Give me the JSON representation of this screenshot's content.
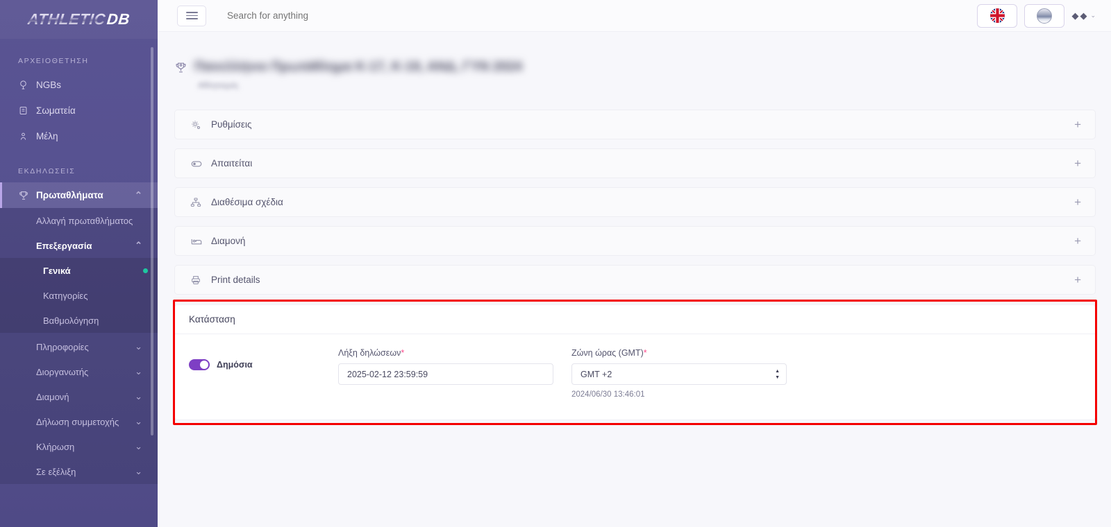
{
  "brand": {
    "name_part1": "ATHLETIC",
    "name_part2": "DB"
  },
  "topbar": {
    "menu_toggle": "hamburger-menu",
    "search_placeholder": "Search for anything",
    "search_value": "",
    "language_icon": "uk-flag-icon",
    "theme_icon": "globe-icon",
    "avatar_caret": "⌄"
  },
  "sidebar": {
    "sections": [
      {
        "label": "ΑΡΧΕΙΟΘΕΤΗΣΗ",
        "items": [
          {
            "label": "NGBs",
            "icon": "globe-icon"
          },
          {
            "label": "Σωματεία",
            "icon": "building-icon"
          },
          {
            "label": "Μέλη",
            "icon": "person-pin-icon"
          }
        ]
      },
      {
        "label": "ΕΚΔΗΛΩΣΕΙΣ",
        "items": [
          {
            "label": "Πρωταθλήματα",
            "icon": "trophy-icon",
            "active": true,
            "chevron": "⌃"
          }
        ]
      }
    ],
    "submenu": [
      {
        "label": "Αλλαγή πρωταθλήματος"
      },
      {
        "label": "Επεξεργασία",
        "chevron": "⌃",
        "bold": true
      }
    ],
    "editing_items": [
      {
        "label": "Γενικά",
        "current": true,
        "dot": true
      },
      {
        "label": "Κατηγορίες"
      },
      {
        "label": "Βαθμολόγηση"
      }
    ],
    "more_items": [
      {
        "label": "Πληροφορίες",
        "chevron": "⌄"
      },
      {
        "label": "Διοργανωτής",
        "chevron": "⌄"
      },
      {
        "label": "Διαμονή",
        "chevron": "⌄"
      },
      {
        "label": "Δήλωση συμμετοχής",
        "chevron": "⌄"
      },
      {
        "label": "Κλήρωση",
        "chevron": "⌄"
      },
      {
        "label": "Σε εξέλιξη",
        "chevron": "⌄"
      }
    ]
  },
  "page": {
    "title_redacted": "Πανελλήνιο Πρωτάθλημα Κ-17, Κ-19, ΑΝΔ, ΓΥΝ 2024",
    "subtitle_redacted": "Αθλητισμός",
    "title_icon": "trophy-icon"
  },
  "panels": [
    {
      "label": "Ρυθμίσεις",
      "icon": "gear-icon",
      "expand": "+"
    },
    {
      "label": "Απαιτείται",
      "icon": "toggle-icon",
      "expand": "+"
    },
    {
      "label": "Διαθέσιμα σχέδια",
      "icon": "sitemap-icon",
      "expand": "+"
    },
    {
      "label": "Διαμονή",
      "icon": "bed-icon",
      "expand": "+"
    },
    {
      "label": "Print details",
      "icon": "printer-icon",
      "expand": "+"
    }
  ],
  "status": {
    "heading": "Κατάσταση",
    "public_toggle_label": "Δημόσια",
    "public_toggle_on": true,
    "deadline_label": "Λήξη δηλώσεων",
    "deadline_required": "*",
    "deadline_value": "2025-02-12 23:59:59",
    "timezone_label": "Ζώνη ώρας (GMT)",
    "timezone_required": "*",
    "timezone_value": "GMT +2",
    "timezone_options": [
      "GMT +2"
    ],
    "timestamp": "2024/06/30 13:46:01"
  },
  "colors": {
    "sidebar": "#565190",
    "accent_purple": "#7e3fc4",
    "highlight_red": "#f40000",
    "status_dot_green": "#1ec7a0"
  }
}
